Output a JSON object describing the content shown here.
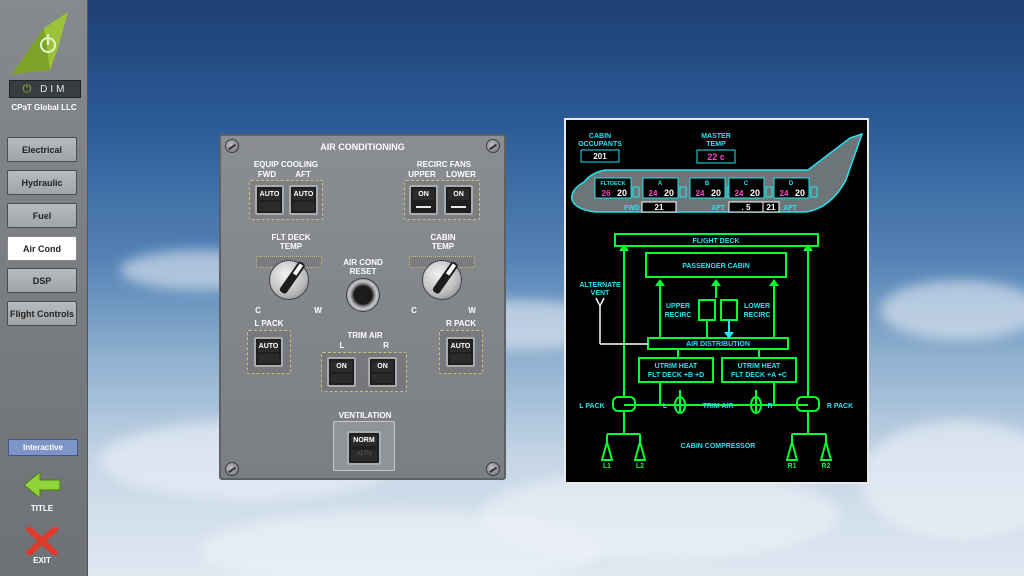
{
  "brand": {
    "name": "DIM",
    "company": "CPaT Global LLC"
  },
  "nav": {
    "items": [
      {
        "label": "Electrical"
      },
      {
        "label": "Hydraulic"
      },
      {
        "label": "Fuel"
      },
      {
        "label": "Air Cond"
      },
      {
        "label": "DSP"
      },
      {
        "label": "Flight Controls"
      }
    ],
    "active_item": "Air Cond",
    "interactive_label": "Interactive",
    "title_label": "TITLE",
    "exit_label": "EXIT"
  },
  "panel": {
    "title": "AIR CONDITIONING",
    "equip_cooling": {
      "label": "EQUIP COOLING",
      "fwd": "FWD",
      "aft": "AFT",
      "fwd_sw": "AUTO",
      "aft_sw": "AUTO"
    },
    "recirc_fans": {
      "label": "RECIRC FANS",
      "upper": "UPPER",
      "lower": "LOWER",
      "upper_sw": "ON",
      "lower_sw": "ON"
    },
    "flt_deck_temp": {
      "line1": "FLT DECK",
      "line2": "TEMP",
      "c": "C",
      "w": "W"
    },
    "cabin_temp": {
      "line1": "CABIN",
      "line2": "TEMP",
      "c": "C",
      "w": "W"
    },
    "air_cond_reset": {
      "line1": "AIR COND",
      "line2": "RESET"
    },
    "l_pack": {
      "label": "L PACK",
      "sw": "AUTO"
    },
    "r_pack": {
      "label": "R PACK",
      "sw": "AUTO"
    },
    "trim_air": {
      "label": "TRIM AIR",
      "l": "L",
      "r": "R",
      "l_sw": "ON",
      "r_sw": "ON"
    },
    "ventilation": {
      "label": "VENTILATION",
      "top": "NORM",
      "bottom": "ALTN"
    }
  },
  "synoptic": {
    "cabin_occupants_l1": "CABIN",
    "cabin_occupants_l2": "OCCUPANTS",
    "occupants_value": "201",
    "master_temp_l1": "MASTER",
    "master_temp_l2": "TEMP",
    "master_temp_value": "22 c",
    "zones": [
      {
        "name": "FLTDECK",
        "target": "26",
        "actual": "20"
      },
      {
        "name": "A",
        "target": "24",
        "actual": "20"
      },
      {
        "name": "B",
        "target": "24",
        "actual": "20"
      },
      {
        "name": "C",
        "target": "24",
        "actual": "20"
      },
      {
        "name": "D",
        "target": "24",
        "actual": "20"
      }
    ],
    "fwd_label": "FWD",
    "fwd_value": "21",
    "aft_label": "AFT",
    "aft_value1": ". 5",
    "aft_value2": "21",
    "aft_label2": "AFT",
    "flight_deck": "FLIGHT DECK",
    "passenger_cabin": "PASSENGER CABIN",
    "alternate_vent_l1": "ALTERNATE",
    "alternate_vent_l2": "VENT",
    "upper_recirc_l1": "UPPER",
    "upper_recirc_l2": "RECIRC",
    "lower_recirc_l1": "LOWER",
    "lower_recirc_l2": "RECIRC",
    "air_distribution": "AIR DISTRIBUTION",
    "utrim_left_l1": "UTRIM HEAT",
    "utrim_left_l2": "FLT DECK +B +D",
    "utrim_right_l1": "UTRIM HEAT",
    "utrim_right_l2": "FLT DECK +A +C",
    "l_pack": "L PACK",
    "r_pack": "R PACK",
    "trim_l": "L",
    "trim_air": "TRIM AIR",
    "trim_r": "R",
    "cabin_compressor": "CABIN COMPRESSOR",
    "compressors": [
      "L1",
      "L2",
      "R1",
      "R2"
    ]
  },
  "colors": {
    "line": "#00ff33",
    "cyan": "#22e6f0",
    "magenta": "#ff44cc",
    "accent_green": "#8fb82a"
  }
}
